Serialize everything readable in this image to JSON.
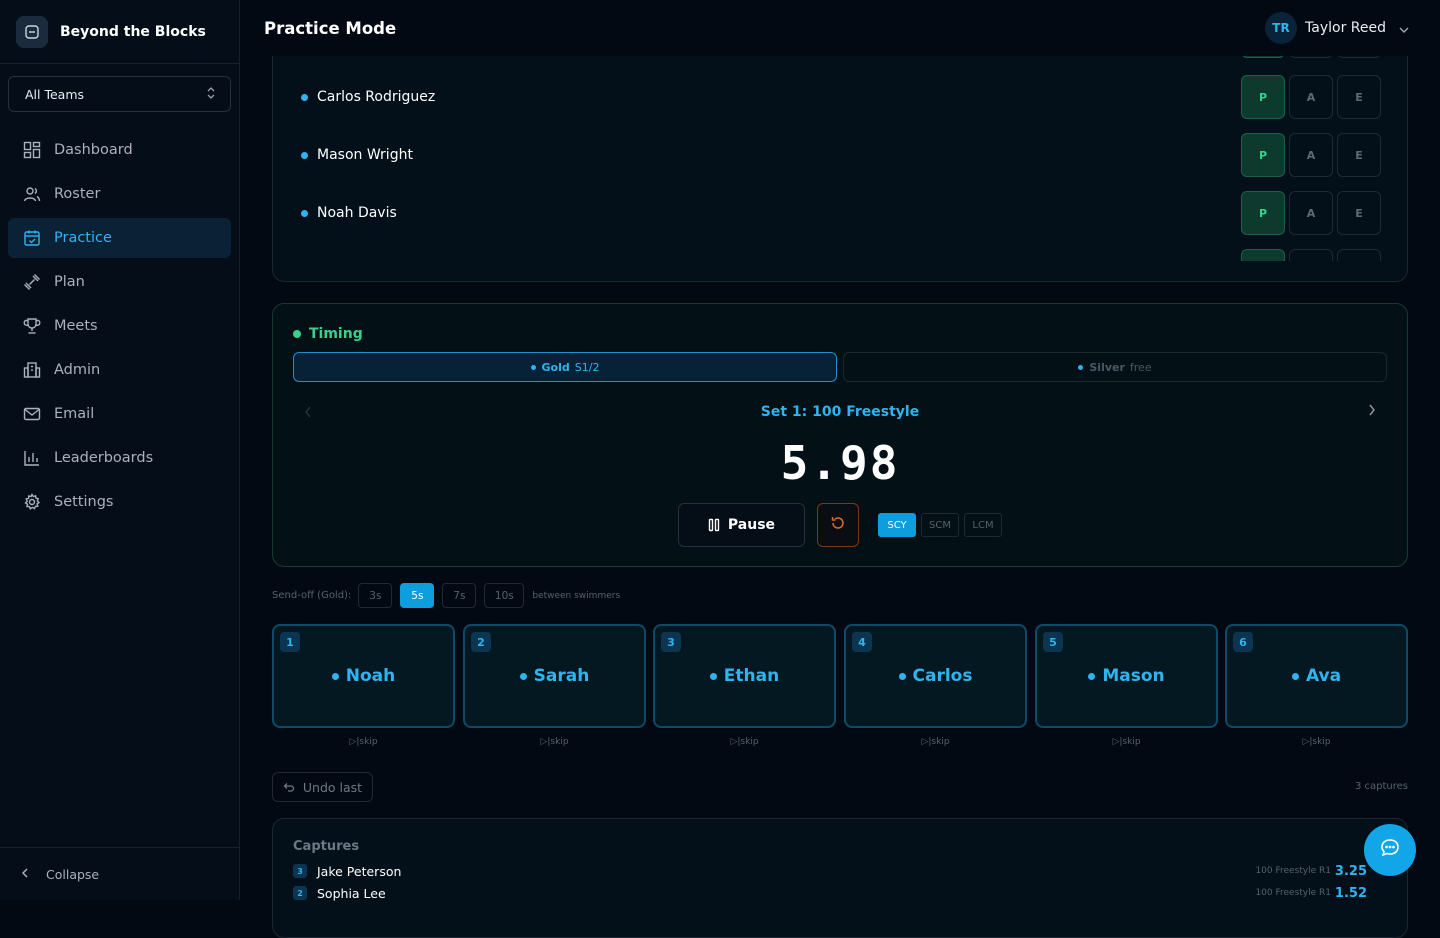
{
  "brand": {
    "name": "Beyond the Blocks"
  },
  "team_select": {
    "value": "All Teams"
  },
  "nav": [
    {
      "label": "Dashboard",
      "icon": "dashboard-icon"
    },
    {
      "label": "Roster",
      "icon": "users-icon"
    },
    {
      "label": "Practice",
      "icon": "calendar-check-icon",
      "active": true
    },
    {
      "label": "Plan",
      "icon": "dumbbell-icon"
    },
    {
      "label": "Meets",
      "icon": "trophy-icon"
    },
    {
      "label": "Admin",
      "icon": "building-icon"
    },
    {
      "label": "Email",
      "icon": "mail-icon"
    },
    {
      "label": "Leaderboards",
      "icon": "bar-chart-icon"
    },
    {
      "label": "Settings",
      "icon": "gear-icon"
    }
  ],
  "collapse_label": "Collapse",
  "header": {
    "title": "Practice Mode"
  },
  "user": {
    "initials": "TR",
    "name": "Taylor Reed"
  },
  "attendance": {
    "rows": [
      {
        "name": "Carlos Rodriguez",
        "status": "P"
      },
      {
        "name": "Mason Wright",
        "status": "P"
      },
      {
        "name": "Noah Davis",
        "status": "P"
      }
    ],
    "buttons": {
      "present": "P",
      "absent": "A",
      "excused": "E"
    }
  },
  "timing": {
    "title": "Timing",
    "groups": [
      {
        "name": "Gold",
        "detail": "S1/2"
      },
      {
        "name": "Silver",
        "detail": "free"
      }
    ],
    "set_title": "Set 1: 100 Freestyle",
    "clock": "5.98",
    "pause_label": "Pause",
    "courses": [
      "SCY",
      "SCM",
      "LCM"
    ],
    "active_course": "SCY"
  },
  "sendoff": {
    "label": "Send-off (Gold):",
    "options": [
      "3s",
      "5s",
      "7s",
      "10s"
    ],
    "active": "5s",
    "trail": "between swimmers"
  },
  "lanes": [
    {
      "num": "1",
      "name": "Noah"
    },
    {
      "num": "2",
      "name": "Sarah"
    },
    {
      "num": "3",
      "name": "Ethan"
    },
    {
      "num": "4",
      "name": "Carlos"
    },
    {
      "num": "5",
      "name": "Mason"
    },
    {
      "num": "6",
      "name": "Ava"
    }
  ],
  "skip_label": "skip",
  "undo_label": "Undo last",
  "capture_count": "3 captures",
  "captures": {
    "title": "Captures",
    "rows": [
      {
        "lane": "3",
        "name": "Jake Peterson",
        "event": "100 Freestyle R1",
        "time": "3.25"
      },
      {
        "lane": "2",
        "name": "Sophia Lee",
        "event": "100 Freestyle R1",
        "time": "1.52"
      }
    ]
  },
  "colors": {
    "accent": "#2fb4ef",
    "present": "#37d08c",
    "background": "#020912",
    "reset": "#e0692a"
  }
}
